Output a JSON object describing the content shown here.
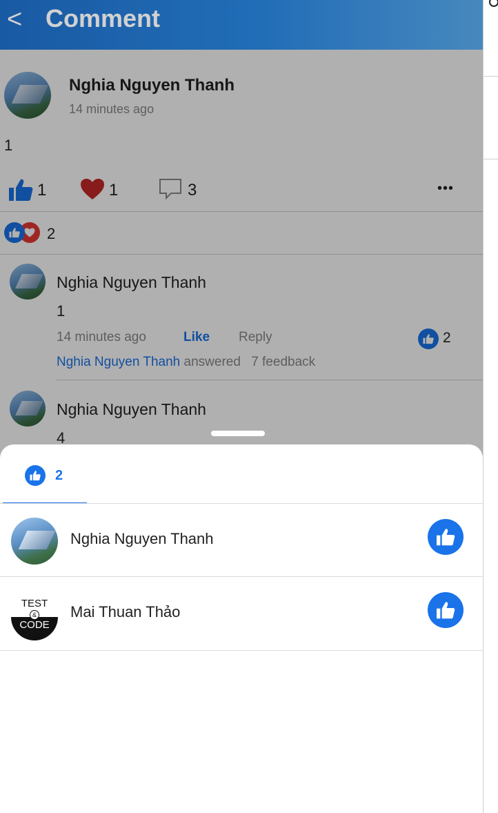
{
  "header": {
    "title": "Comment",
    "back_glyph": "<"
  },
  "post": {
    "author": "Nghia  Nguyen Thanh",
    "time": "14 minutes ago",
    "body": "1",
    "like_count": "1",
    "heart_count": "1",
    "comment_count": "3",
    "more_glyph": "•••",
    "reaction_total": "2"
  },
  "comments": [
    {
      "name": "Nghia  Nguyen Thanh",
      "text": "1",
      "time": "14 minutes ago",
      "like_label": "Like",
      "reply_label": "Reply",
      "like_count": "2",
      "answer_name": "Nghia  Nguyen Thanh",
      "answer_verb": "answered",
      "feedback": "7  feedback"
    },
    {
      "name": "Nghia  Nguyen Thanh",
      "text": "4"
    }
  ],
  "sheet": {
    "tab_count": "2",
    "users": [
      {
        "name": "Nghia  Nguyen Thanh",
        "avatar": "building-photo"
      },
      {
        "name": "Mai Thuan Thảo",
        "avatar": "test-code-logo"
      }
    ],
    "logo_top": "TEST",
    "logo_mid": "&",
    "logo_bottom": "CODE"
  },
  "colors": {
    "accent": "#1a73e8",
    "heart": "#e53935",
    "header_start": "#1f6ec8",
    "header_end": "#57a7e8"
  }
}
